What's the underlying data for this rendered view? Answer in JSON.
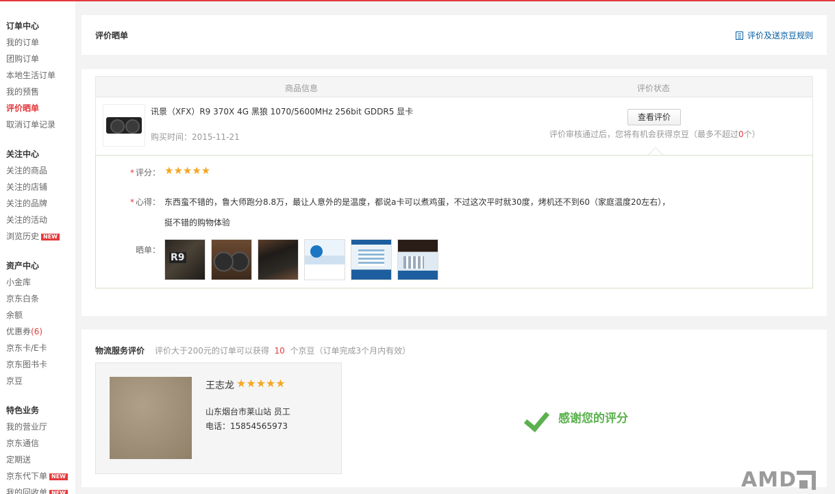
{
  "sidebar": {
    "groups": [
      {
        "title": "订单中心",
        "items": [
          {
            "label": "我的订单"
          },
          {
            "label": "团购订单"
          },
          {
            "label": "本地生活订单"
          },
          {
            "label": "我的预售"
          },
          {
            "label": "评价晒单",
            "active": true
          },
          {
            "label": "取消订单记录"
          }
        ]
      },
      {
        "title": "关注中心",
        "items": [
          {
            "label": "关注的商品"
          },
          {
            "label": "关注的店铺"
          },
          {
            "label": "关注的品牌"
          },
          {
            "label": "关注的活动"
          },
          {
            "label": "浏览历史",
            "badge": "NEW"
          }
        ]
      },
      {
        "title": "资产中心",
        "items": [
          {
            "label": "小金库"
          },
          {
            "label": "京东白条"
          },
          {
            "label": "余额"
          },
          {
            "label": "优惠券",
            "count": "(6)"
          },
          {
            "label": "京东卡/E卡"
          },
          {
            "label": "京东图书卡"
          },
          {
            "label": "京豆"
          }
        ]
      },
      {
        "title": "特色业务",
        "items": [
          {
            "label": "我的营业厅"
          },
          {
            "label": "京东通信"
          },
          {
            "label": "定期送"
          },
          {
            "label": "京东代下单",
            "badge": "NEW"
          },
          {
            "label": "我的回收单",
            "badge": "NEW"
          }
        ]
      }
    ]
  },
  "header": {
    "title": "评价晒单",
    "rules_link": "评价及送京豆规则",
    "rules_icon": "list-icon"
  },
  "table": {
    "col_info": "商品信息",
    "col_status": "评价状态"
  },
  "product": {
    "name": "讯景（XFX）R9 370X 4G 黑狼 1070/5600MHz 256bit GDDR5 显卡",
    "purchase_label": "购买时间：",
    "purchase_date": "2015-11-21",
    "view_button": "查看评价",
    "tip_prefix": "评价审核通过后，您将有机会获得京豆（最多不超过",
    "tip_num": "0",
    "tip_suffix": "个）"
  },
  "review": {
    "rating_label": "评分：",
    "rating": 5,
    "stars": "★★★★★",
    "content_label": "心得：",
    "content_line1": "东西蛮不错的，鲁大师跑分8.8万，最让人意外的是温度，都说a卡可以煮鸡蛋，不过这次平时就30度，烤机还不到60（家庭温度20左右），",
    "content_line2": "挺不错的购物体验",
    "photos_label": "晒单："
  },
  "logistics": {
    "title": "物流服务评价",
    "desc_prefix": "评价大于200元的订单可以获得",
    "desc_num": "10",
    "desc_suffix": "个京豆（订单完成3个月内有效）",
    "courier_name": "王志龙",
    "courier_rating": 5,
    "courier_stars": "★★★★★",
    "courier_station": "山东烟台市莱山站 员工",
    "courier_phone": "电话：15854565973",
    "thanks": "感谢您的评分"
  },
  "watermark": "AMD",
  "colors": {
    "accent": "#e4393c",
    "star": "#f5a623",
    "success": "#5bb14e",
    "link": "#005aa0"
  }
}
